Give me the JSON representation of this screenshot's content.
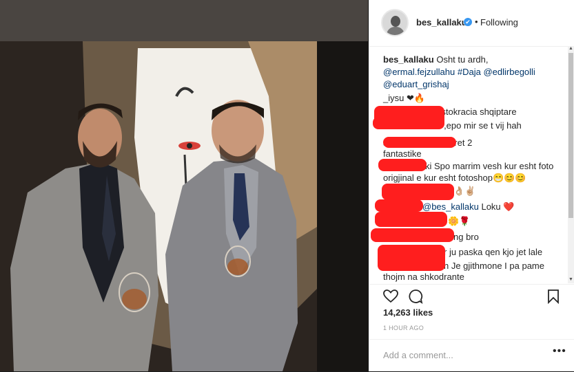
{
  "post": {
    "username": "bes_kallaku",
    "verified_icon": "✔",
    "separator": "•",
    "follow_status": "Following",
    "avatar_icon": "profile-avatar"
  },
  "caption": {
    "user": "bes_kallaku",
    "text": "Osht tu ardh,",
    "line2": [
      {
        "text": "@ermal.fejzullahu",
        "link": true
      },
      {
        "text": " ",
        "link": false
      },
      {
        "text": "#Daja",
        "link": true
      },
      {
        "text": " ",
        "link": false
      },
      {
        "text": "@edlirbegolli",
        "link": true
      }
    ],
    "line3": "@eduart_grishaj"
  },
  "comments": [
    {
      "text": "_iysu ❤🔥"
    },
    {
      "text": "aristokracia shqiptare"
    },
    {
      "text": "uu ,epo mir se t vij hah"
    },
    {
      "text": "s                isi Jeni me te miret 2"
    },
    {
      "text": "fantastike"
    },
    {
      "text": "ki Spo marrim vesh kur esht foto"
    },
    {
      "text": "origjinal e kur esht fotoshop😁😊😊"
    },
    {
      "text": "👌🏼✌🏼"
    },
    {
      "mention": "@bes_kallaku",
      "text": " Loku ❤️"
    },
    {
      "text": "🌼🌹"
    },
    {
      "text": "ng bro"
    },
    {
      "text": "r ju paska qen kjo jet lale"
    },
    {
      "text": "n Je gjithmone I pa pame"
    },
    {
      "text": "thojm na shkodrante"
    }
  ],
  "actions": {
    "like_icon": "heart-icon",
    "comment_icon": "comment-icon",
    "save_icon": "bookmark-icon"
  },
  "likes": "14,263 likes",
  "timestamp": "1 HOUR AGO",
  "add_comment": {
    "placeholder": "Add a comment...",
    "more": "•••"
  },
  "colors": {
    "link": "#003569",
    "verified": "#3897f0",
    "redaction": "#ff1e1e"
  }
}
